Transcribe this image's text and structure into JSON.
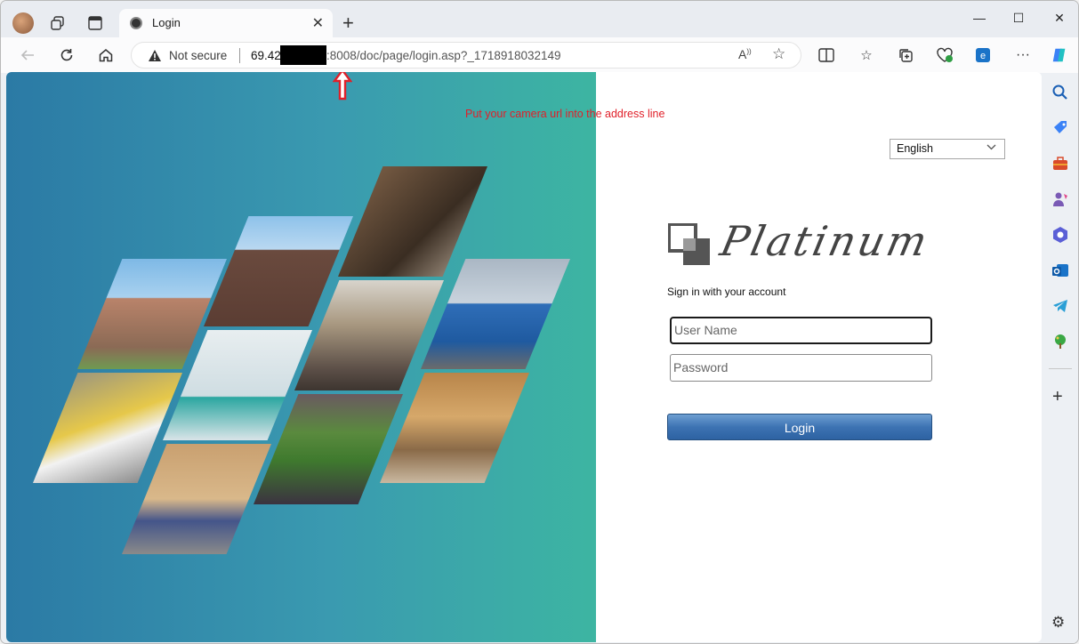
{
  "browser": {
    "tab_title": "Login",
    "address_not_secure": "Not secure",
    "url_visible_prefix": "69.42",
    "url_visible_suffix": ":8008/doc/page/login.asp?_1718918032149"
  },
  "annotation": {
    "text": "Put your camera url into the address line",
    "color": "#e0202a"
  },
  "login_page": {
    "language_selected": "English",
    "brand_name": "Platinum",
    "signin_heading": "Sign in with your account",
    "username_placeholder": "User Name",
    "password_placeholder": "Password",
    "login_button": "Login"
  },
  "colors": {
    "hero_gradient_start": "#2b7aa5",
    "hero_gradient_end": "#3db5a2",
    "login_button": "#3d73b3"
  },
  "icons": {
    "tabstrip": [
      "workspaces-icon",
      "tab-actions-icon",
      "new-tab-icon"
    ],
    "toolbar": [
      "back-icon",
      "refresh-icon",
      "home-icon",
      "read-aloud-icon",
      "favorite-star-icon",
      "split-screen-icon",
      "favorites-icon",
      "collections-icon",
      "browser-essentials-icon",
      "edge-icon",
      "more-icon",
      "copilot-icon"
    ],
    "sidebar": [
      "search-icon",
      "shopping-icon",
      "tools-icon",
      "games-icon",
      "office-icon",
      "outlook-icon",
      "telegram-icon",
      "tree-icon",
      "add-icon",
      "settings-icon"
    ]
  }
}
